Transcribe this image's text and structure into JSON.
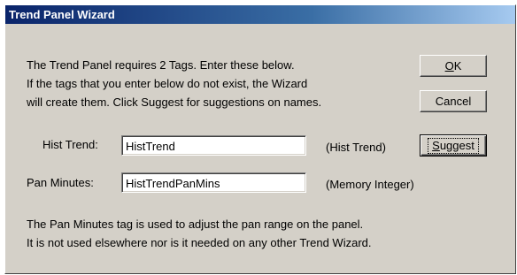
{
  "window": {
    "title": "Trend Panel Wizard"
  },
  "intro": {
    "line1": "The Trend Panel requires 2 Tags.  Enter these below.",
    "line2": "If the tags that you enter below do not exist, the Wizard",
    "line3": "will create them.  Click Suggest for suggestions on names."
  },
  "buttons": {
    "ok": {
      "accel": "O",
      "rest": "K"
    },
    "cancel": {
      "label": "Cancel"
    },
    "suggest": {
      "accel": "S",
      "rest": "uggest"
    }
  },
  "fields": {
    "hist_trend": {
      "label": "Hist Trend:",
      "value": "HistTrend",
      "type": "(Hist Trend)"
    },
    "pan_minutes": {
      "label": "Pan Minutes:",
      "value": "HistTrendPanMins",
      "type": "(Memory Integer)"
    }
  },
  "note": {
    "line1": "The Pan Minutes tag is used to adjust the pan range on the panel.",
    "line2": "It is not used elsewhere nor is it needed on any other Trend Wizard."
  },
  "colors": {
    "dialog_face": "#d4d0c8",
    "title_start": "#0a246a",
    "title_end": "#a6caf0"
  }
}
